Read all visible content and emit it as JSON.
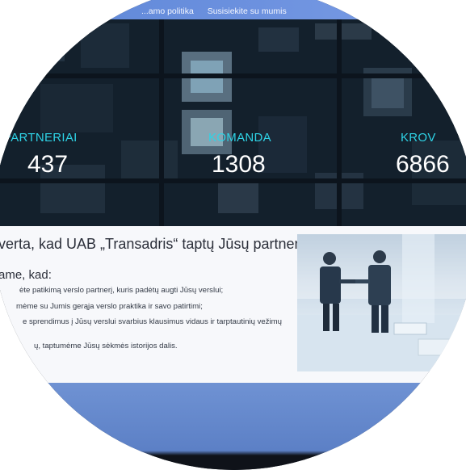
{
  "nav": {
    "links": [
      "...amo politika",
      "Susisiekite su mumis"
    ]
  },
  "stats": [
    {
      "label": "PARTNERIAI",
      "value": "437"
    },
    {
      "label": "KOMANDA",
      "value": "1308"
    },
    {
      "label": "KROV",
      "value": "6866"
    }
  ],
  "content": {
    "headline": "verta, kad UAB „Transadris“ taptų Jūsų partneriu?",
    "subhead": "ame, kad:",
    "lines": [
      "ėte patikimą verslo partnerį, kuris padėtų augti Jūsų verslui;",
      "mėme su Jumis gerąja verslo praktika ir savo patirtimi;",
      "e sprendimus į Jūsų verslui svarbius klausimus vidaus ir tarptautinių vežimų",
      "ų, taptumėme Jūsų sėkmės istorijos dalis."
    ]
  },
  "colors": {
    "nav_bg": "#6c91df",
    "stat_label": "#2fd3e6",
    "content_bg": "#f7f8fb",
    "band": "#5c80c6"
  }
}
